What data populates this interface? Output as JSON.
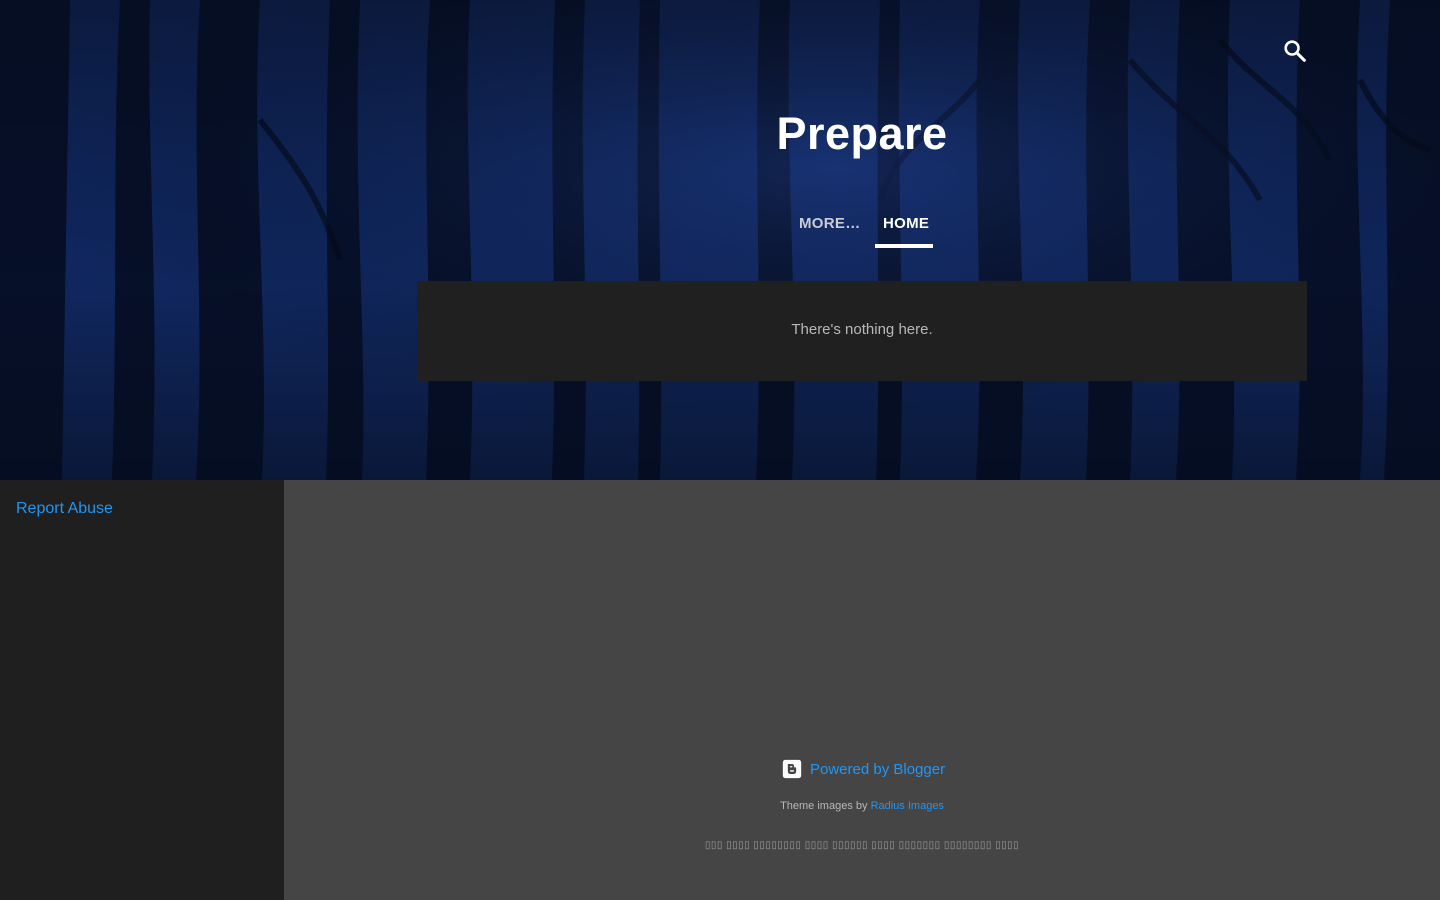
{
  "header": {
    "title": "Prepare",
    "search_icon": "search-icon"
  },
  "nav": {
    "items": [
      {
        "label": "MORE…",
        "active": false
      },
      {
        "label": "HOME",
        "active": true
      }
    ]
  },
  "content": {
    "empty_message": "There's nothing here."
  },
  "sidebar": {
    "report_abuse": "Report Abuse"
  },
  "footer": {
    "powered_by": "Powered by Blogger",
    "blogger_icon": "blogger-icon",
    "credits_prefix": "Theme images by",
    "credits_link": "Radius Images",
    "foreign_text": "▯▯▯ ▯▯▯▯ ▯▯▯▯▯▯▯▯ ▯▯▯▯ ▯▯▯▯▯▯ ▯▯▯▯ ▯▯▯▯▯▯▯ ▯▯▯▯▯▯▯▯ ▯▯▯▯"
  },
  "colors": {
    "link": "#2196f3",
    "sidebar_bg": "#1f1f1f",
    "main_bg": "#454545",
    "panel_bg": "#202020",
    "hero_blue": "#10275e"
  }
}
